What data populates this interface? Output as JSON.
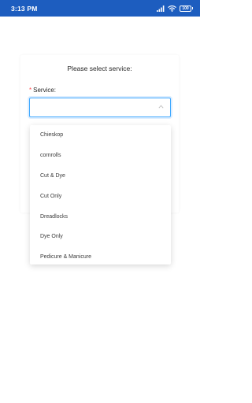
{
  "status_bar": {
    "time": "3:13 PM",
    "battery": "100"
  },
  "card": {
    "title": "Please select service:"
  },
  "service_field": {
    "required_mark": "*",
    "label": "Service:",
    "value": ""
  },
  "dropdown": {
    "options": [
      "Chieskop",
      "cornrolls",
      "Cut & Dye",
      "Cut Only",
      "Dreadlocks",
      "Dye Only",
      "Pedicure & Manicure"
    ]
  }
}
